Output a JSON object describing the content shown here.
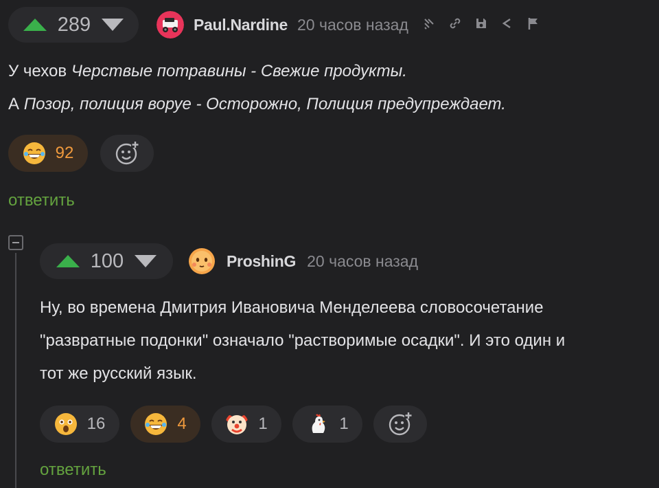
{
  "comment1": {
    "rating": "289",
    "author": "Paul.Nardine",
    "time": "20 часов назад",
    "line1_pre": "У чехов ",
    "line1_it": "Черствые потравины - Свежие продукты.",
    "line2_pre": "А ",
    "line2_it": "Позор, полиция воруе - Осторожно, Полиция предупреждает.",
    "reactions": [
      {
        "icon": "laughing-emoji",
        "count": "92"
      }
    ],
    "reply_label": "ответить"
  },
  "comment2": {
    "rating": "100",
    "author": "ProshinG",
    "time": "20 часов назад",
    "text_lines": [
      "Ну, во времена Дмитрия Ивановича Менделеева словосочетание",
      "\"развратные подонки\" означало \"растворимые осадки\". И это один и",
      "тот же русский язык."
    ],
    "reactions": [
      {
        "icon": "shocked-emoji",
        "count": "16"
      },
      {
        "icon": "laughing-emoji",
        "count": "4"
      },
      {
        "icon": "clown-emoji",
        "count": "1"
      },
      {
        "icon": "chicken-emoji",
        "count": "1"
      }
    ],
    "reply_label": "ответить"
  },
  "colors": {
    "upvote": "#3ab04b",
    "reply": "#64a33f",
    "active_reaction": "#f09a3d"
  }
}
